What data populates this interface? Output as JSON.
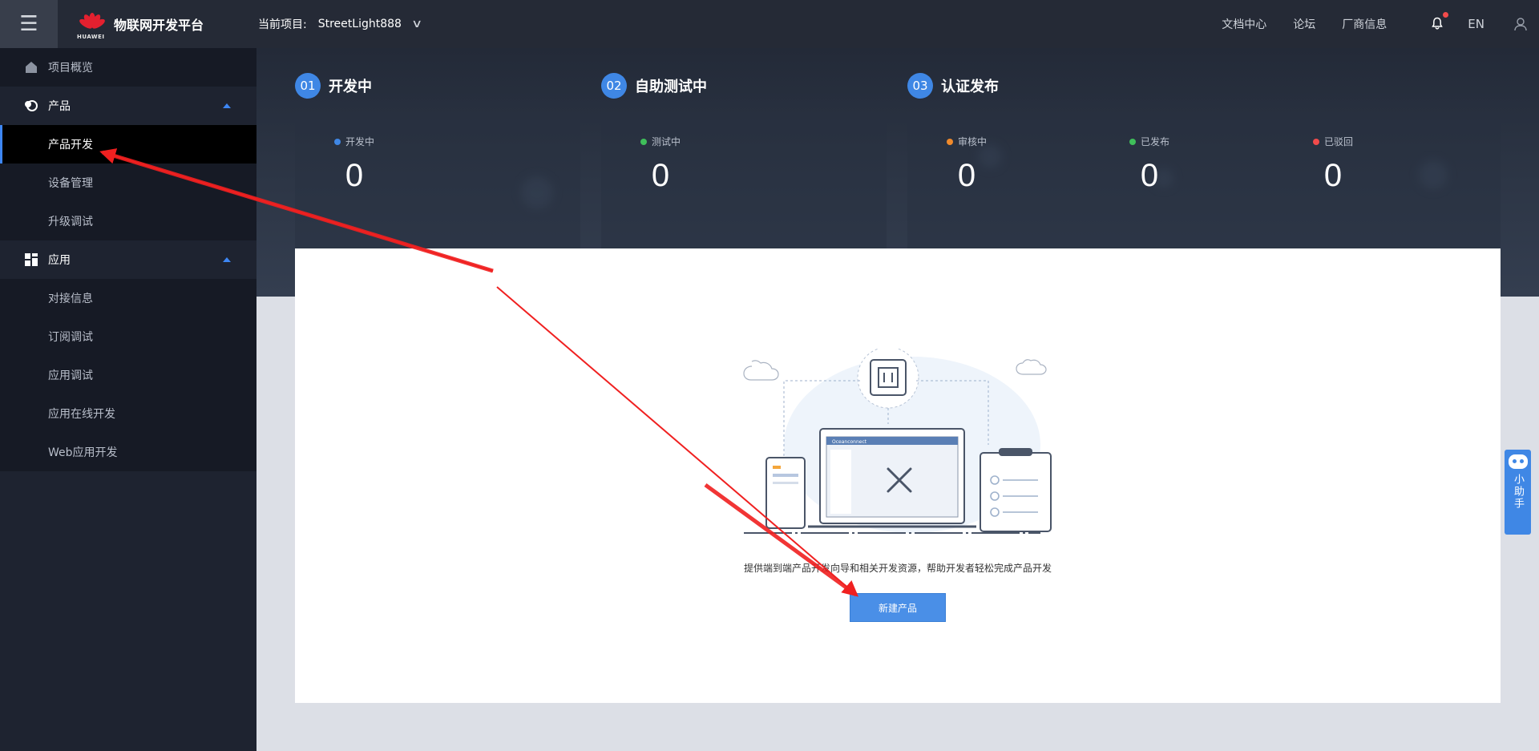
{
  "topbar": {
    "menu_icon": "hamburger-icon",
    "brand_small": "HUAWEI",
    "platform_title": "物联网开发平台",
    "project_label": "当前项目:",
    "project_name": "StreetLight888",
    "links": [
      "文档中心",
      "论坛",
      "厂商信息"
    ],
    "lang": "EN"
  },
  "sidebar": {
    "overview": "项目概览",
    "product_group": "产品",
    "product_items": [
      "产品开发",
      "设备管理",
      "升级调试"
    ],
    "app_group": "应用",
    "app_items": [
      "对接信息",
      "订阅调试",
      "应用调试",
      "应用在线开发",
      "Web应用开发"
    ],
    "active_item": "产品开发"
  },
  "stages": [
    {
      "num": "01",
      "title": "开发中"
    },
    {
      "num": "02",
      "title": "自助测试中"
    },
    {
      "num": "03",
      "title": "认证发布"
    }
  ],
  "stats": [
    {
      "label": "开发中",
      "value": "0",
      "color": "#3f87e5"
    },
    {
      "label": "测试中",
      "value": "0",
      "color": "#3fbf5a"
    },
    {
      "label": "审核中",
      "value": "0",
      "color": "#f08a2b"
    },
    {
      "label": "已发布",
      "value": "0",
      "color": "#3fbf5a"
    },
    {
      "label": "已驳回",
      "value": "0",
      "color": "#f24b4b"
    }
  ],
  "main": {
    "description": "提供端到端产品开发向导和相关开发资源，帮助开发者轻松完成产品开发",
    "new_product_button": "新建产品",
    "illustration_window_title": "Oceanconnect"
  },
  "helper": {
    "label": "小助手"
  },
  "colors": {
    "accent": "#3f87e5",
    "topbar": "#252a36",
    "sidebar": "#1e2330",
    "annotation": "#f02020"
  }
}
